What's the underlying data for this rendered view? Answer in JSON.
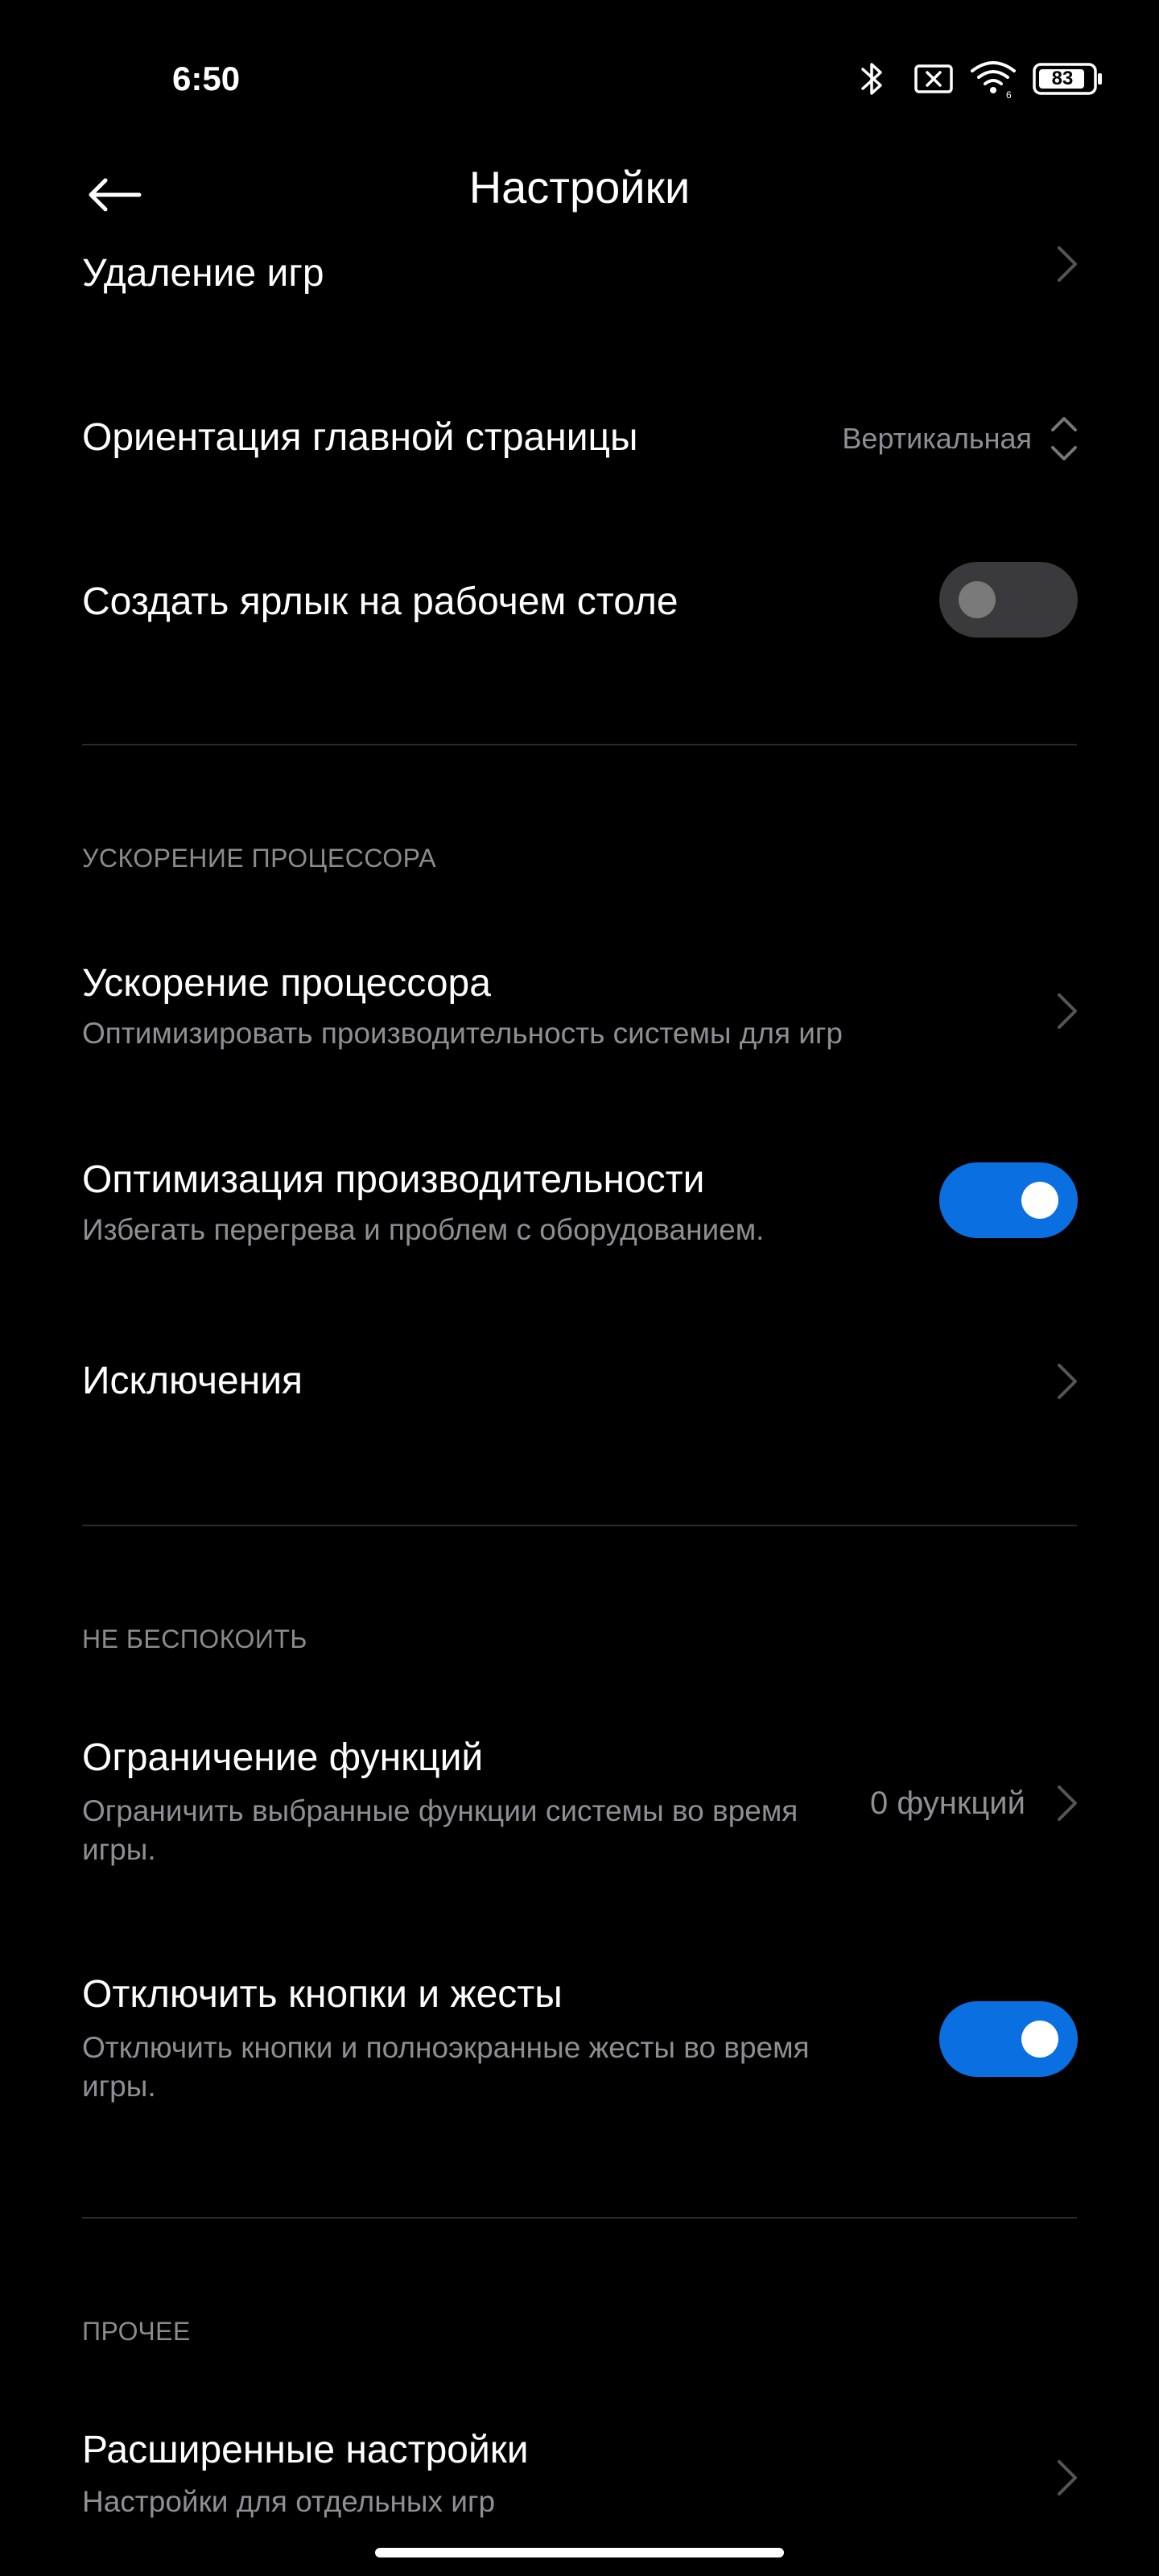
{
  "status_bar": {
    "time": "6:50",
    "battery": "83",
    "icons": [
      "bluetooth-icon",
      "no-sim-icon",
      "wifi-icon",
      "battery-icon"
    ]
  },
  "header": {
    "title": "Настройки",
    "back_icon": "arrow-left-icon"
  },
  "rows_top": {
    "remove_games": "Удаление игр",
    "orientation": {
      "label": "Ориентация главной страницы",
      "value": "Вертикальная"
    },
    "shortcut": {
      "label": "Создать ярлык на рабочем столе",
      "enabled": false
    }
  },
  "cpu_section": {
    "header": "УСКОРЕНИЕ ПРОЦЕССОРА",
    "boost": {
      "label": "Ускорение процессора",
      "sub": "Оптимизировать производительность системы для игр"
    },
    "perf": {
      "label": "Оптимизация производительности",
      "sub": "Избегать перегрева и проблем с оборудованием.",
      "enabled": true
    },
    "exceptions": {
      "label": "Исключения"
    }
  },
  "dnd_section": {
    "header": "НЕ БЕСПОКОИТЬ",
    "limit": {
      "label": "Ограничение функций",
      "sub": "Ограничить выбранные функции системы во время игры.",
      "value": "0 функций"
    },
    "gestures": {
      "label": "Отключить кнопки и жесты",
      "sub": "Отключить кнопки и полноэкранные жесты во время игры.",
      "enabled": true
    }
  },
  "other_section": {
    "header": "ПРОЧЕЕ",
    "advanced": {
      "label": "Расширенные настройки",
      "sub": "Настройки для отдельных игр"
    }
  },
  "colors": {
    "background": "#000000",
    "accent": "#0a6fe0",
    "secondary_text": "#8e8e93"
  }
}
